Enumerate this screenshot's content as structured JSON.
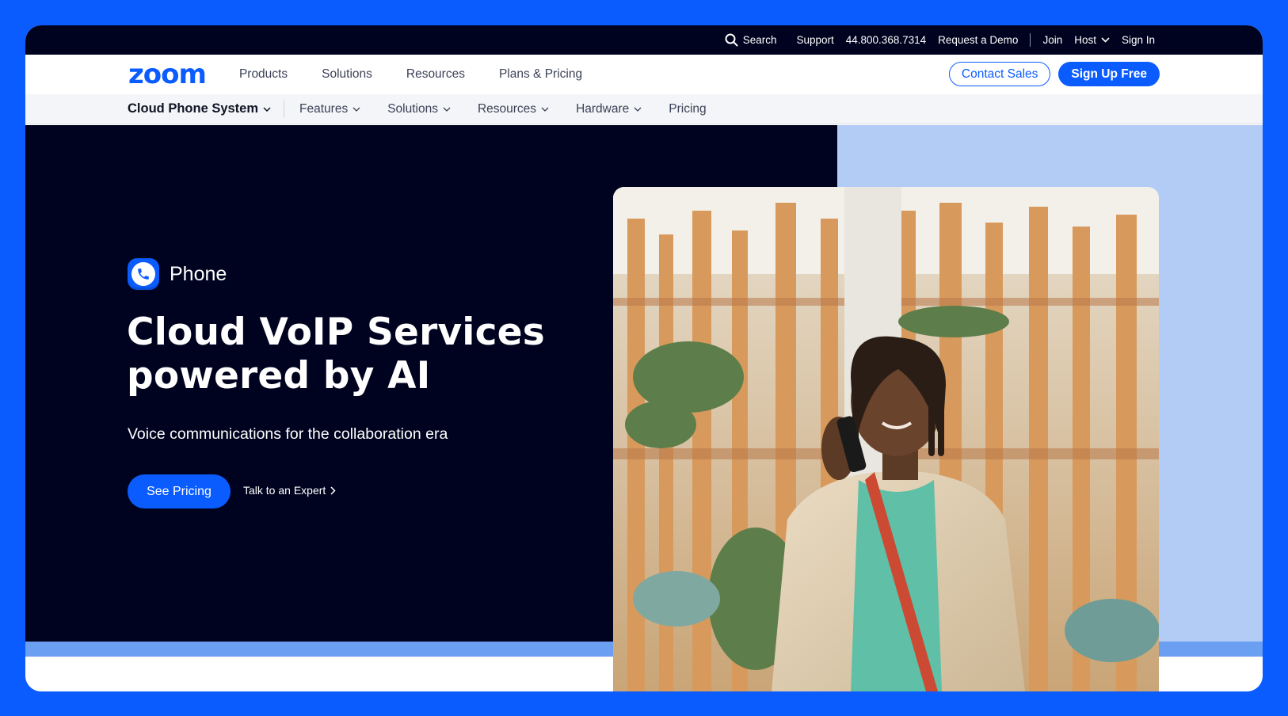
{
  "utility": {
    "search": "Search",
    "support": "Support",
    "phone": "44.800.368.7314",
    "demo": "Request a Demo",
    "join": "Join",
    "host": "Host",
    "signin": "Sign In"
  },
  "nav": {
    "logo": "zoom",
    "links": [
      "Products",
      "Solutions",
      "Resources",
      "Plans & Pricing"
    ],
    "contact": "Contact Sales",
    "signup": "Sign Up Free"
  },
  "subnav": {
    "product": "Cloud Phone System",
    "links": [
      "Features",
      "Solutions",
      "Resources",
      "Hardware"
    ],
    "pricing": "Pricing"
  },
  "hero": {
    "product_label": "Phone",
    "title_line1": "Cloud VoIP Services",
    "title_line2": "powered by AI",
    "subtitle": "Voice communications for the collaboration era",
    "cta_primary": "See Pricing",
    "cta_secondary": "Talk to an Expert"
  },
  "colors": {
    "brand_blue": "#0b5cff",
    "navy": "#00031f",
    "light_blue": "#b2ccf6",
    "strip_blue": "#6b9ff2"
  }
}
